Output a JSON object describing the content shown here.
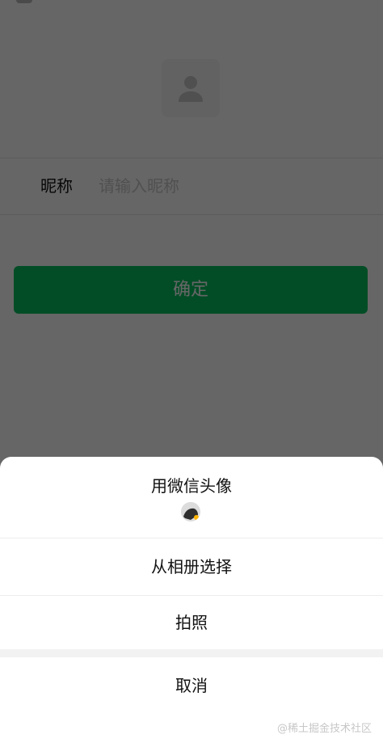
{
  "form": {
    "nickname_label": "昵称",
    "nickname_placeholder": "请输入昵称",
    "confirm_label": "确定"
  },
  "action_sheet": {
    "wechat_avatar_label": "用微信头像",
    "album_label": "从相册选择",
    "camera_label": "拍照",
    "cancel_label": "取消"
  },
  "watermark_text": "@稀土掘金技术社区",
  "icons": {
    "avatar_placeholder": "user-icon",
    "wechat_avatar": "user-avatar-icon"
  },
  "colors": {
    "primary_green": "#07c160",
    "mask": "#000000",
    "sheet_background": "#ffffff"
  }
}
